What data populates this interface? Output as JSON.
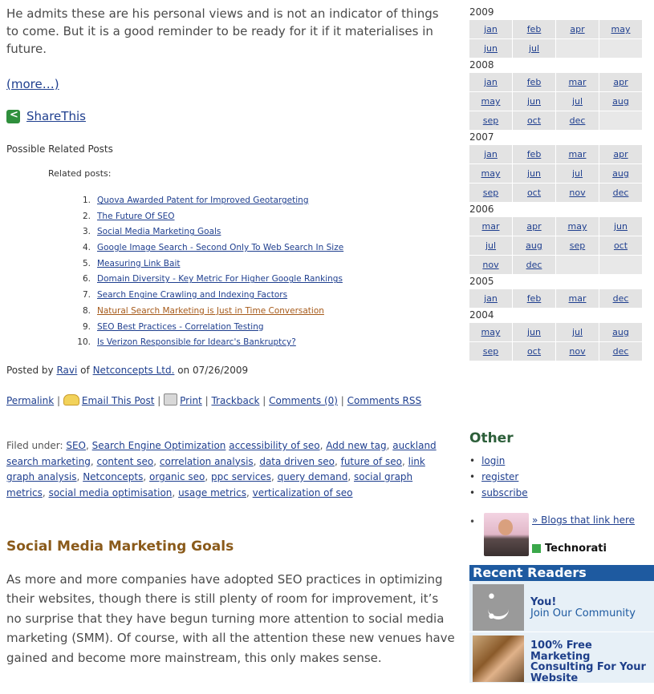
{
  "main": {
    "intro_text": "He admits these are his personal views and is not an indicator of things to come. But it is a good reminder to be ready for it if it materialises in future.",
    "more_link": "(more…)",
    "share_label": "ShareThis",
    "related_title": "Possible Related Posts",
    "related_subtitle": "Related posts:",
    "related_posts": [
      {
        "num": "1.",
        "title": "Quova Awarded Patent for Improved Geotargeting"
      },
      {
        "num": "2.",
        "title": "The Future Of SEO"
      },
      {
        "num": "3.",
        "title": "Social Media Marketing Goals"
      },
      {
        "num": "4.",
        "title": "Google Image Search - Second Only To Web Search In Size"
      },
      {
        "num": "5.",
        "title": "Measuring Link Bait"
      },
      {
        "num": "6.",
        "title": "Domain Diversity - Key Metric For Higher Google Rankings"
      },
      {
        "num": "7.",
        "title": "Search Engine Crawling and Indexing Factors"
      },
      {
        "num": "8.",
        "title": "Natural Search Marketing is Just in Time Conversation"
      },
      {
        "num": "9.",
        "title": "SEO Best Practices - Correlation Testing"
      },
      {
        "num": "10.",
        "title": "Is Verizon Responsible for Idearc's Bankruptcy?"
      }
    ],
    "posted": {
      "prefix": "Posted by",
      "author": "Ravi",
      "of": "of",
      "company": "Netconcepts Ltd.",
      "on": "on 07/26/2009"
    },
    "links": {
      "permalink": "Permalink",
      "email": "Email This Post",
      "print": "Print",
      "trackback": "Trackback",
      "comments": "Comments (0)",
      "comments_rss": "Comments RSS",
      "sep": "|"
    },
    "filed_prefix": "Filed under:",
    "tags": [
      "SEO",
      "Search Engine Optimization",
      "accessibility of seo",
      "Add new tag",
      "auckland search marketing",
      "content seo",
      "correlation analysis",
      "data driven seo",
      "future of seo",
      "link graph analysis",
      "Netconcepts",
      "organic seo",
      "ppc services",
      "query demand",
      "social graph metrics",
      "social media optimisation",
      "usage metrics",
      "verticalization of seo"
    ],
    "next_post_title": "Social Media Marketing Goals",
    "next_post_body": "As more and more companies have adopted SEO practices in optimizing their websites, though there is still plenty of room for improvement, it’s no surprise that they have begun turning more attention to social media marketing (SMM). Of course, with all the attention these new venues have gained and become more mainstream, this only makes sense."
  },
  "sidebar": {
    "archive": [
      {
        "year": "2009",
        "months": [
          "jan",
          "feb",
          "apr",
          "may",
          "jun",
          "jul",
          "",
          ""
        ]
      },
      {
        "year": "2008",
        "months": [
          "jan",
          "feb",
          "mar",
          "apr",
          "may",
          "jun",
          "jul",
          "aug",
          "sep",
          "oct",
          "dec",
          ""
        ]
      },
      {
        "year": "2007",
        "months": [
          "jan",
          "feb",
          "mar",
          "apr",
          "may",
          "jun",
          "jul",
          "aug",
          "sep",
          "oct",
          "nov",
          "dec"
        ]
      },
      {
        "year": "2006",
        "months": [
          "mar",
          "apr",
          "may",
          "jun",
          "jul",
          "aug",
          "sep",
          "oct",
          "nov",
          "dec",
          "",
          ""
        ]
      },
      {
        "year": "2005",
        "months": [
          "jan",
          "feb",
          "mar",
          "dec"
        ]
      },
      {
        "year": "2004",
        "months": [
          "may",
          "jun",
          "jul",
          "aug",
          "sep",
          "oct",
          "nov",
          "dec"
        ]
      }
    ],
    "other_title": "Other",
    "other_links": [
      "login",
      "register",
      "subscribe"
    ],
    "technorati": {
      "blogs_link": "» Blogs that link here",
      "logo_text": "Technorati"
    },
    "recent_readers": {
      "header": "Recent Readers",
      "you_name": "You!",
      "you_sub": "Join Our Community",
      "promo": "100% Free Marketing Consulting For Your Website"
    }
  },
  "colors": {
    "link": "#1f3f8f",
    "visited_link": "#a65a1a",
    "post_title": "#8a5a1a",
    "other_title": "#2d5f3a",
    "readers_header_bg": "#1e5aa0",
    "archive_cell_bg": "#e3e3e3"
  }
}
